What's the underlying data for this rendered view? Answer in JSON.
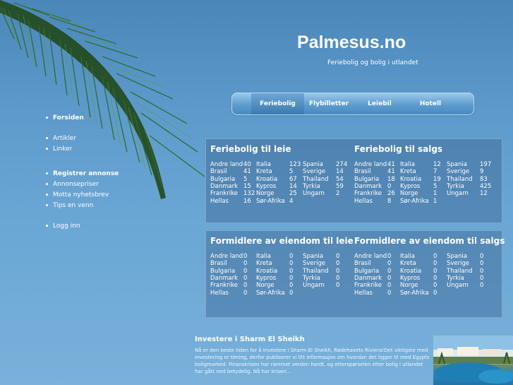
{
  "site": {
    "title": "Palmesus.no",
    "tagline": "Feriebolig og bolig i utlandet"
  },
  "nav": {
    "tabs": [
      {
        "label": "Feriebolig"
      },
      {
        "label": "Flybilletter"
      },
      {
        "label": "Leiebil"
      },
      {
        "label": "Hotell"
      }
    ]
  },
  "sidebar": {
    "items": [
      {
        "label": "Forsiden"
      },
      {
        "label": "Artikler"
      },
      {
        "label": "Linker"
      },
      {
        "label": "Registrer annonse"
      },
      {
        "label": "Annonsepriser"
      },
      {
        "label": "Motta nyhetsbrev"
      },
      {
        "label": "Tips en venn"
      },
      {
        "label": "Logg inn"
      }
    ]
  },
  "panels": {
    "ferie_leie": {
      "title": "Feriebolig til leie",
      "rows": [
        [
          "Andre land",
          "40",
          "Italia",
          "123",
          "Spania",
          "274"
        ],
        [
          "Brasil",
          "41",
          "Kreta",
          "5",
          "Sverige",
          "14"
        ],
        [
          "Bulgaria",
          "5",
          "Kroatia",
          "67",
          "Thailand",
          "54"
        ],
        [
          "Danmark",
          "15",
          "Kypros",
          "14",
          "Tyrkia",
          "59"
        ],
        [
          "Frankrike",
          "132",
          "Norge",
          "25",
          "Ungarn",
          "2"
        ],
        [
          "Hellas",
          "16",
          "Sør-Afrika",
          "4",
          "",
          ""
        ]
      ]
    },
    "ferie_salg": {
      "title": "Feriebolig til salgs",
      "rows": [
        [
          "Andre land",
          "41",
          "Italia",
          "12",
          "Spania",
          "197"
        ],
        [
          "Brasil",
          "41",
          "Kreta",
          "7",
          "Sverige",
          "9"
        ],
        [
          "Bulgaria",
          "18",
          "Kroatia",
          "19",
          "Thailand",
          "83"
        ],
        [
          "Danmark",
          "0",
          "Kypros",
          "5",
          "Tyrkia",
          "425"
        ],
        [
          "Frankrike",
          "26",
          "Norge",
          "1",
          "Ungarn",
          "12"
        ],
        [
          "Hellas",
          "8",
          "Sør-Afrika",
          "1",
          "",
          ""
        ]
      ]
    },
    "form_leie": {
      "title": "Formidlere av eiendom til leie",
      "rows": [
        [
          "Andre land",
          "0",
          "Italia",
          "0",
          "Spania",
          "0"
        ],
        [
          "Brasil",
          "0",
          "Kreta",
          "0",
          "Sverige",
          "0"
        ],
        [
          "Bulgaria",
          "0",
          "Kroatia",
          "0",
          "Thailand",
          "0"
        ],
        [
          "Danmark",
          "0",
          "Kypros",
          "0",
          "Tyrkia",
          "0"
        ],
        [
          "Frankrike",
          "0",
          "Norge",
          "0",
          "Ungarn",
          "0"
        ],
        [
          "Hellas",
          "0",
          "Sør-Afrika",
          "0",
          "",
          ""
        ]
      ]
    },
    "form_salg": {
      "title": "Formidlere av eiendom til salgs",
      "rows": [
        [
          "Andre land",
          "0",
          "Italia",
          "0",
          "Spania",
          "0"
        ],
        [
          "Brasil",
          "0",
          "Kreta",
          "0",
          "Sverige",
          "0"
        ],
        [
          "Bulgaria",
          "0",
          "Kroatia",
          "0",
          "Thailand",
          "0"
        ],
        [
          "Danmark",
          "0",
          "Kypros",
          "0",
          "Tyrkia",
          "0"
        ],
        [
          "Frankrike",
          "0",
          "Norge",
          "0",
          "Ungarn",
          "0"
        ],
        [
          "Hellas",
          "0",
          "Sør-Afrika",
          "0",
          "",
          ""
        ]
      ]
    }
  },
  "article": {
    "title": "Investere i Sharm El Sheikh",
    "text": "Nå er den beste tiden for å investere i Sharm El Sheikh, Rødehavets Riviera!Det viktigste med investering er timing, derfor publiserer vi litt informasjon om hvordan det ligger til med Egypts boligmarked. Finanskrisen har rammet verden hardt, og etterspørselen etter bolig i utlandet har gått ned betydelig. Nå har krisen..."
  }
}
